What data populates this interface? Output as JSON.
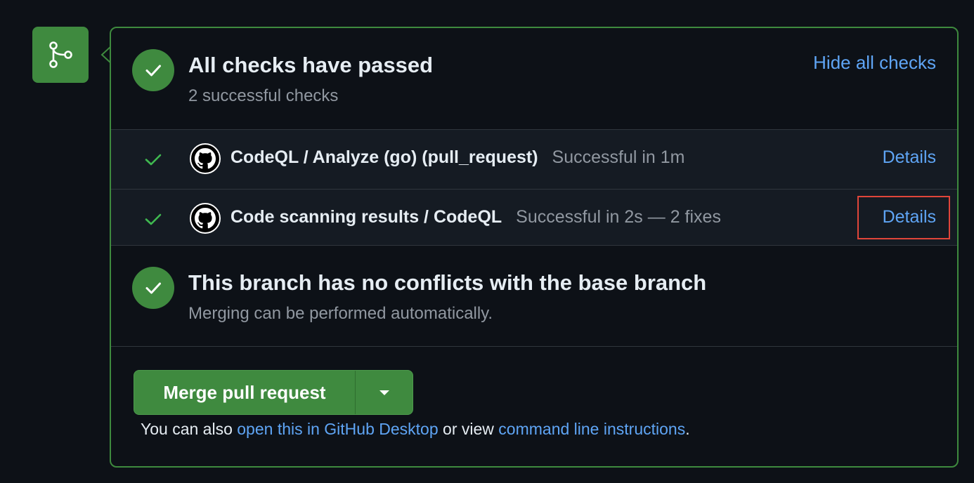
{
  "merge_box": {
    "status": {
      "title": "All checks have passed",
      "subtitle": "2 successful checks",
      "toggle_label": "Hide all checks"
    },
    "checks": [
      {
        "name": "CodeQL / Analyze (go) (pull_request)",
        "status": "Successful in 1m",
        "link_label": "Details"
      },
      {
        "name": "Code scanning results / CodeQL",
        "status": "Successful in 2s — 2 fixes",
        "link_label": "Details"
      }
    ],
    "conflicts": {
      "title": "This branch has no conflicts with the base branch",
      "subtitle": "Merging can be performed automatically."
    },
    "merge": {
      "button_label": "Merge pull request",
      "note_prefix": "You can also ",
      "desktop_link": "open this in GitHub Desktop",
      "note_middle": " or view ",
      "cli_link": "command line instructions",
      "note_suffix": "."
    }
  },
  "colors": {
    "background": "#0d1117",
    "success_green": "#3f8a3f",
    "link_blue": "#5fa5f5",
    "highlight_red": "#e0453a"
  },
  "icons": {
    "merge_badge": "git-merge-icon",
    "status": "check-circle-icon",
    "check_tick": "check-icon",
    "app_avatar": "github-logo-icon",
    "dropdown": "caret-down-icon"
  }
}
